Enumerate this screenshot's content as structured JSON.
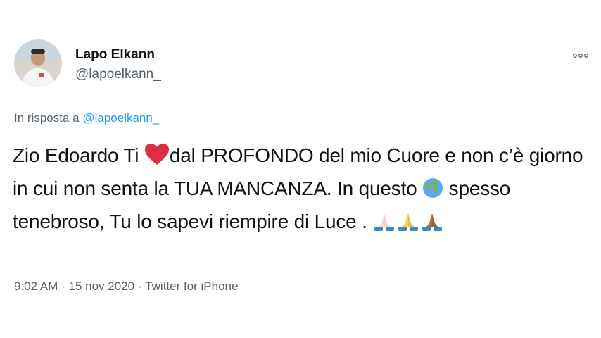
{
  "tweet": {
    "author": {
      "name": "Lapo Elkann",
      "handle": "@lapoelkann_",
      "avatar_icon": "user-avatar-photo"
    },
    "more_icon": "more-options-icon",
    "reply": {
      "prefix": "In risposta a",
      "handle": "@lapoelkann_"
    },
    "text": {
      "part1": "Zio Edoardo Ti ",
      "emoji_heart": "red-heart-emoji",
      "part2": "dal PROFONDO del mio Cuore e non c’è giorno in cui non senta la TUA MANCANZA. In questo ",
      "emoji_globe": "globe-emoji",
      "part3": " spesso tenebroso, Tu lo sapevi riempire di Luce . ",
      "emoji_pray": [
        "praying-hands-light-emoji",
        "praying-hands-yellow-emoji",
        "praying-hands-dark-emoji"
      ]
    },
    "meta": {
      "time": "9:02 AM",
      "separator1": " · ",
      "date": "15 nov 2020",
      "separator2": " · ",
      "source": "Twitter for iPhone"
    },
    "colors": {
      "text": "#0f1419",
      "secondary": "#536471",
      "link": "#1d9bf0",
      "heart": "#e0245e"
    }
  }
}
